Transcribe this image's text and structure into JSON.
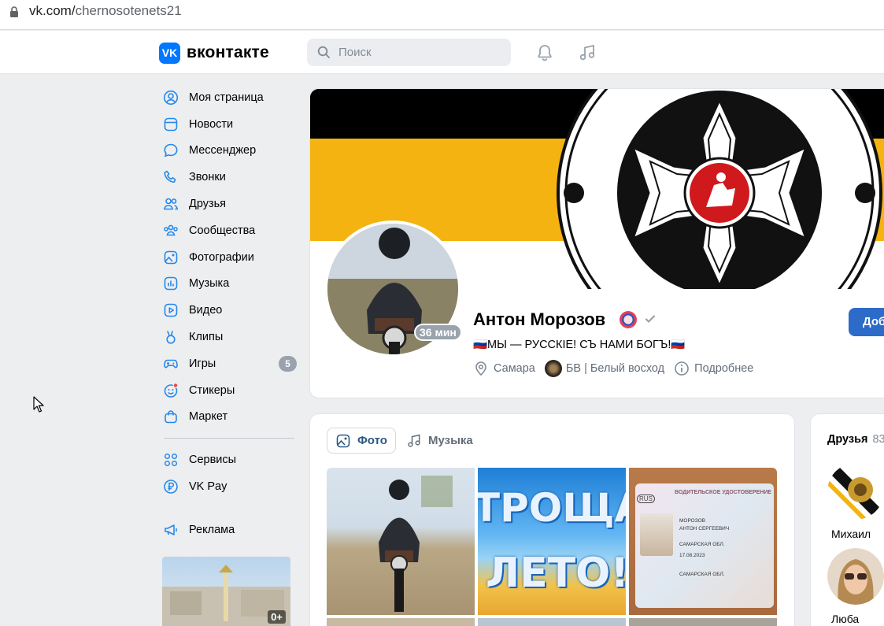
{
  "browser": {
    "url_domain": "vk.com/",
    "url_path": "chernosotenets21"
  },
  "header": {
    "logo_text": "вконтакте",
    "search_placeholder": "Поиск",
    "icons": [
      "bell-icon",
      "music-note-icon"
    ]
  },
  "nav": {
    "items": [
      {
        "label": "Моя страница",
        "icon": "user-circle-icon"
      },
      {
        "label": "Новости",
        "icon": "news-icon"
      },
      {
        "label": "Мессенджер",
        "icon": "chat-bubble-icon"
      },
      {
        "label": "Звонки",
        "icon": "phone-icon"
      },
      {
        "label": "Друзья",
        "icon": "friends-icon"
      },
      {
        "label": "Сообщества",
        "icon": "communities-icon"
      },
      {
        "label": "Фотографии",
        "icon": "photo-icon"
      },
      {
        "label": "Музыка",
        "icon": "music-bars-icon"
      },
      {
        "label": "Видео",
        "icon": "video-icon"
      },
      {
        "label": "Клипы",
        "icon": "clips-icon"
      },
      {
        "label": "Игры",
        "icon": "gamepad-icon",
        "badge": "5"
      },
      {
        "label": "Стикеры",
        "icon": "sticker-icon"
      },
      {
        "label": "Маркет",
        "icon": "shopping-bag-icon"
      }
    ],
    "secondary": [
      {
        "label": "Сервисы",
        "icon": "grid-icon"
      },
      {
        "label": "VK Pay",
        "icon": "ruble-icon"
      }
    ],
    "ads": {
      "label": "Реклама",
      "icon": "megaphone-icon",
      "age_rating": "0+"
    }
  },
  "profile": {
    "name": "Антон Морозов",
    "online": "36 мин",
    "status": "🇷🇺МЫ — РУССКIЕ! СЪ НАМИ БОГЪ!🇷🇺",
    "city": "Самара",
    "group": "БВ | Белый восход",
    "more": "Подробнее",
    "add_button": "Доб",
    "cover_colors": [
      "#000000",
      "#f4b310",
      "#ffffff"
    ]
  },
  "media": {
    "tabs": [
      {
        "label": "Фото",
        "icon": "photo-icon",
        "active": true
      },
      {
        "label": "Музыка",
        "icon": "music-note-icon",
        "active": false
      }
    ]
  },
  "friends": {
    "title": "Друзья",
    "count": "83",
    "items": [
      {
        "name": "Михаил"
      },
      {
        "name": "Люба"
      }
    ]
  }
}
